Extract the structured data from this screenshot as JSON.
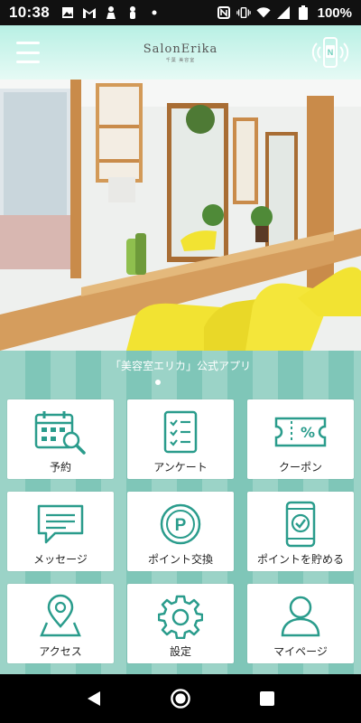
{
  "status_bar": {
    "time": "10:38",
    "battery": "100%"
  },
  "header": {
    "logo_main": "SalonErika",
    "logo_sub": "千葉 美容室"
  },
  "hero": {
    "alt": "salon interior photo"
  },
  "banner": {
    "tagline": "「美容室エリカ」公式アプリ"
  },
  "menu": [
    {
      "label": "予約",
      "icon": "calendar-search-icon"
    },
    {
      "label": "アンケート",
      "icon": "checklist-icon"
    },
    {
      "label": "クーポン",
      "icon": "coupon-ticket-icon"
    },
    {
      "label": "メッセージ",
      "icon": "message-icon"
    },
    {
      "label": "ポイント交換",
      "icon": "point-coin-icon"
    },
    {
      "label": "ポイントを貯める",
      "icon": "phone-check-icon"
    },
    {
      "label": "アクセス",
      "icon": "map-pin-icon"
    },
    {
      "label": "設定",
      "icon": "gear-icon"
    },
    {
      "label": "マイページ",
      "icon": "user-icon"
    }
  ],
  "colors": {
    "accent": "#2a9c8c",
    "stripe_light": "#9bd3c7",
    "stripe_dark": "#7fc6b8",
    "header_top": "#b8f0e4"
  }
}
